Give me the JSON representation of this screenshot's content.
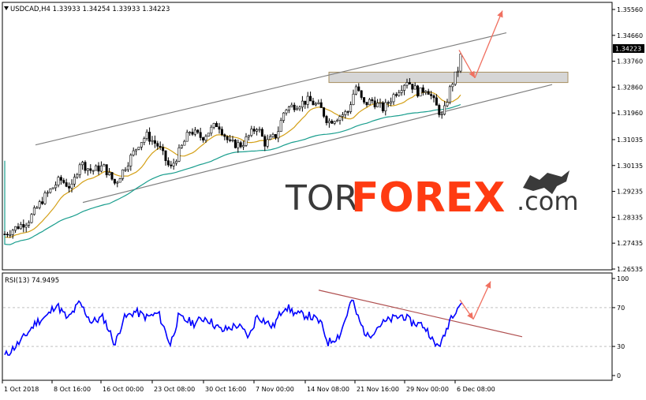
{
  "main_panel": {
    "title": "USDCAD,H4  1.33933 1.34254 1.33933 1.34223",
    "price_labels": [
      "1.35560",
      "1.34660",
      "1.33760",
      "1.32860",
      "1.31960",
      "1.31035",
      "1.30135",
      "1.29235",
      "1.28335",
      "1.27435",
      "1.26535"
    ],
    "current_price": "1.34223",
    "watermark": {
      "part1": "TOR",
      "part2": "FOREX",
      "part3": ".com"
    }
  },
  "rsi_panel": {
    "title": "RSI(13) 74.9495",
    "levels": [
      "100",
      "70",
      "30",
      "0"
    ]
  },
  "time_axis": {
    "labels": [
      "1 Oct 2018",
      "8 Oct 16:00",
      "16 Oct 00:00",
      "23 Oct 08:00",
      "30 Oct 16:00",
      "7 Nov 00:00",
      "14 Nov 08:00",
      "21 Nov 16:00",
      "29 Nov 00:00",
      "6 Dec 08:00"
    ]
  },
  "colors": {
    "up_candle": "#ffffff",
    "down_candle": "#000000",
    "ma_fast": "#d4a017",
    "ma_slow": "#1a9e8e",
    "rsi_line": "#0000ff",
    "channel": "#808080",
    "arrow": "#f07060",
    "zone": "#c8c8c8",
    "rsi_trendline": "#b05050",
    "watermark_dark": "#3a3a3a",
    "watermark_accent": "#ff3b12"
  },
  "chart_data": {
    "type": "line",
    "symbol": "USDCAD,H4",
    "ylim": [
      1.26535,
      1.3556
    ],
    "x_labels": [
      "1 Oct 2018",
      "8 Oct 16:00",
      "16 Oct 00:00",
      "23 Oct 08:00",
      "30 Oct 16:00",
      "7 Nov 00:00",
      "14 Nov 08:00",
      "21 Nov 16:00",
      "29 Nov 00:00",
      "6 Dec 08:00"
    ],
    "close_points": [
      [
        0,
        1.2775
      ],
      [
        30,
        1.2822
      ],
      [
        50,
        1.2903
      ],
      [
        70,
        1.2965
      ],
      [
        85,
        1.2935
      ],
      [
        95,
        1.3025
      ],
      [
        110,
        1.2995
      ],
      [
        125,
        1.301
      ],
      [
        140,
        1.295
      ],
      [
        155,
        1.302
      ],
      [
        170,
        1.309
      ],
      [
        180,
        1.3118
      ],
      [
        195,
        1.308
      ],
      [
        210,
        1.3
      ],
      [
        220,
        1.3055
      ],
      [
        235,
        1.3135
      ],
      [
        250,
        1.311
      ],
      [
        270,
        1.316
      ],
      [
        285,
        1.309
      ],
      [
        300,
        1.3085
      ],
      [
        320,
        1.315
      ],
      [
        330,
        1.309
      ],
      [
        345,
        1.312
      ],
      [
        355,
        1.321
      ],
      [
        370,
        1.3225
      ],
      [
        385,
        1.324
      ],
      [
        400,
        1.3215
      ],
      [
        410,
        1.3165
      ],
      [
        420,
        1.318
      ],
      [
        435,
        1.32
      ],
      [
        445,
        1.329
      ],
      [
        455,
        1.3225
      ],
      [
        465,
        1.324
      ],
      [
        480,
        1.321
      ],
      [
        495,
        1.3265
      ],
      [
        510,
        1.331
      ],
      [
        525,
        1.3265
      ],
      [
        535,
        1.3285
      ],
      [
        545,
        1.323
      ],
      [
        555,
        1.318
      ],
      [
        565,
        1.3285
      ],
      [
        575,
        1.335
      ],
      [
        580,
        1.34223
      ]
    ],
    "rsi": {
      "name": "RSI(13)",
      "last": 74.9495,
      "ylim": [
        0,
        100
      ],
      "levels": [
        70,
        30
      ],
      "points": [
        [
          0,
          20
        ],
        [
          20,
          35
        ],
        [
          40,
          55
        ],
        [
          55,
          62
        ],
        [
          65,
          74
        ],
        [
          80,
          58
        ],
        [
          95,
          75
        ],
        [
          110,
          55
        ],
        [
          125,
          60
        ],
        [
          140,
          32
        ],
        [
          150,
          58
        ],
        [
          165,
          66
        ],
        [
          180,
          60
        ],
        [
          195,
          64
        ],
        [
          210,
          32
        ],
        [
          220,
          60
        ],
        [
          240,
          54
        ],
        [
          255,
          60
        ],
        [
          275,
          46
        ],
        [
          295,
          52
        ],
        [
          310,
          40
        ],
        [
          320,
          62
        ],
        [
          340,
          50
        ],
        [
          355,
          72
        ],
        [
          370,
          63
        ],
        [
          385,
          62
        ],
        [
          400,
          55
        ],
        [
          410,
          34
        ],
        [
          425,
          42
        ],
        [
          440,
          78
        ],
        [
          450,
          55
        ],
        [
          460,
          40
        ],
        [
          475,
          52
        ],
        [
          490,
          58
        ],
        [
          505,
          62
        ],
        [
          515,
          55
        ],
        [
          530,
          52
        ],
        [
          540,
          42
        ],
        [
          545,
          30
        ],
        [
          555,
          35
        ],
        [
          565,
          60
        ],
        [
          575,
          72
        ],
        [
          580,
          74.9
        ]
      ]
    }
  }
}
